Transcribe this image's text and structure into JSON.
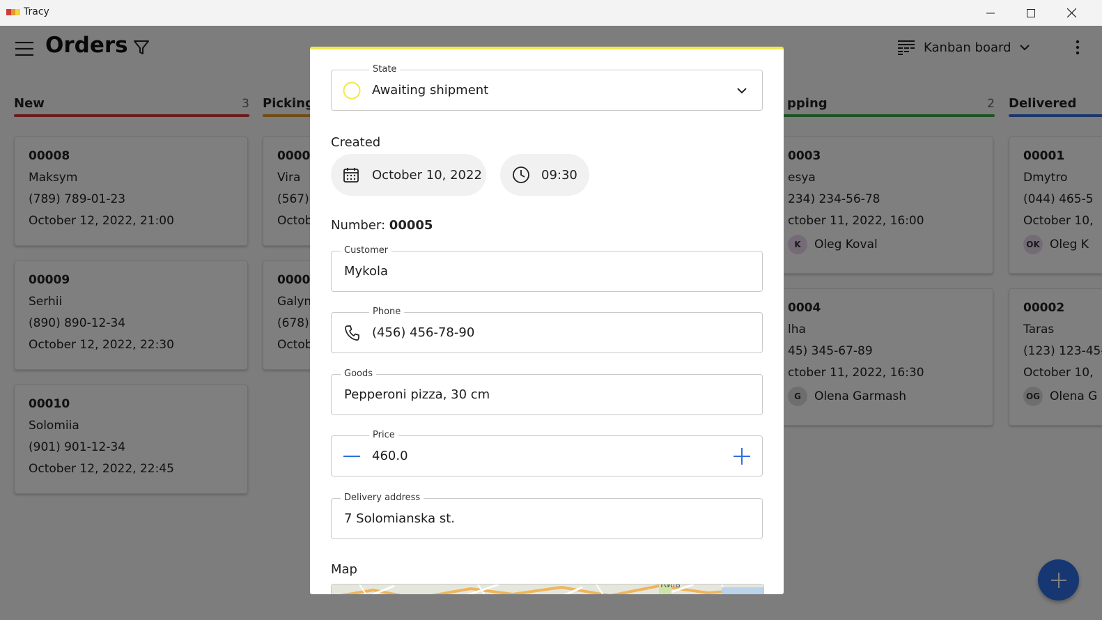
{
  "window": {
    "title": "Tracy",
    "minimize_icon": "minimize-icon",
    "maximize_icon": "maximize-icon",
    "close_icon": "close-icon"
  },
  "header": {
    "title": "Orders",
    "view_label": "Kanban board"
  },
  "columns": [
    {
      "name": "New",
      "count": "3",
      "color": "#d33a3a",
      "cards": [
        {
          "number": "00008",
          "customer": "Maksym",
          "phone": "(789) 789-01-23",
          "date": "October 12, 2022, 21:00"
        },
        {
          "number": "00009",
          "customer": "Serhii",
          "phone": "(890) 890-12-34",
          "date": "October 12, 2022, 22:30"
        },
        {
          "number": "00010",
          "customer": "Solomiia",
          "phone": "(901) 901-12-34",
          "date": "October 12, 2022, 22:45"
        }
      ]
    },
    {
      "name": "Picking",
      "count": "",
      "color": "#e39b2b",
      "cards": [
        {
          "number": "0000",
          "customer": "Vira",
          "phone": "(567)",
          "date": "Octob"
        },
        {
          "number": "0000",
          "customer": "Galyn",
          "phone": "(678)",
          "date": "Octob"
        }
      ]
    },
    {
      "name": "pping",
      "count": "2",
      "color": "#3ba64a",
      "cards": [
        {
          "number": "0003",
          "customer": "esya",
          "phone": "234) 234-56-78",
          "date": "ctober 11, 2022, 16:00",
          "user_initials": "K",
          "user_name": "Oleg Koval"
        },
        {
          "number": "0004",
          "customer": "lha",
          "phone": "45) 345-67-89",
          "date": "ctober 11, 2022, 16:30",
          "user_initials": "G",
          "user_name": "Olena Garmash"
        }
      ]
    },
    {
      "name": "Delivered",
      "count": "",
      "color": "#3c6fd6",
      "cards": [
        {
          "number": "00001",
          "customer": "Dmytro",
          "phone": "(044) 465-5",
          "date": "October 10,",
          "user_initials": "OK",
          "user_name": "Oleg K"
        },
        {
          "number": "00002",
          "customer": "Taras",
          "phone": "(123) 123-45-",
          "date": "October 10,",
          "user_initials": "OG",
          "user_name": "Olena G"
        }
      ]
    }
  ],
  "dialog": {
    "accent_color": "#f2e84a",
    "state": {
      "legend": "State",
      "value": "Awaiting shipment"
    },
    "created": {
      "label": "Created",
      "date": "October 10, 2022",
      "time": "09:30"
    },
    "number": {
      "label": "Number:",
      "value": "00005"
    },
    "customer": {
      "legend": "Customer",
      "value": "Mykola"
    },
    "phone": {
      "legend": "Phone",
      "value": "(456) 456-78-90"
    },
    "goods": {
      "legend": "Goods",
      "value": "Pepperoni pizza, 30 cm"
    },
    "price": {
      "legend": "Price",
      "value": "460.0"
    },
    "address": {
      "legend": "Delivery address",
      "value": "7 Solomianska st."
    },
    "map": {
      "label": "Map",
      "place_label": "Київ"
    }
  }
}
